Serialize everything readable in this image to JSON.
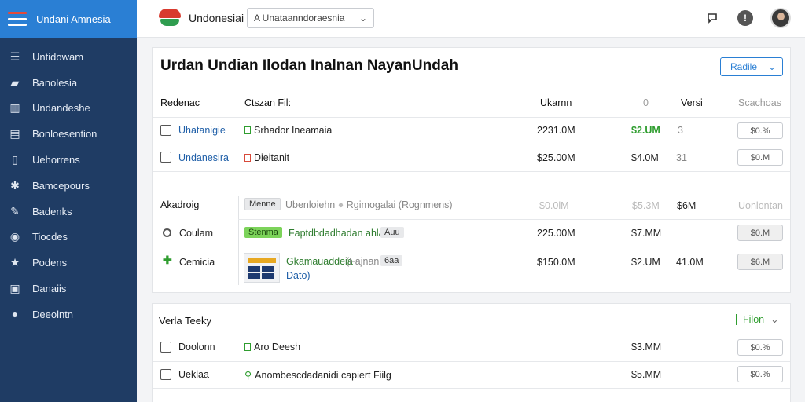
{
  "sidebar": {
    "title": "Undani Amnesia",
    "items": [
      {
        "label": "Untidowam",
        "icon": "list-icon"
      },
      {
        "label": "Banolesia",
        "icon": "bank-icon"
      },
      {
        "label": "Undandeshe",
        "icon": "chart-icon"
      },
      {
        "label": "Bonloesention",
        "icon": "document-icon"
      },
      {
        "label": "Uehorrens",
        "icon": "book-icon"
      },
      {
        "label": "Bamcepours",
        "icon": "puzzle-icon"
      },
      {
        "label": "Badenks",
        "icon": "pencil-icon"
      },
      {
        "label": "Tiocdes",
        "icon": "circle-icon"
      },
      {
        "label": "Podens",
        "icon": "star-icon"
      },
      {
        "label": "Danaiis",
        "icon": "briefcase-icon"
      },
      {
        "label": "Deeolntn",
        "icon": "search-icon"
      }
    ]
  },
  "topbar": {
    "site_name": "Undonesiai",
    "language_value": "A Unataanndoraesnia",
    "icons": [
      "chat-icon",
      "help-icon",
      "user-avatar"
    ]
  },
  "main": {
    "title": "Urdan Undian Ilodan Inalnan NayanUndah",
    "action_button": "Radile",
    "headers": [
      "Redenac",
      "Ctszan Fil:",
      "Ukarnn",
      "0",
      "Versi",
      "Scachoas"
    ],
    "rows": [
      {
        "name": "Uhatanigie",
        "tag": "Srhador Ineamaia",
        "amount": "2231.0M",
        "value": "$2.UM",
        "count": "3",
        "button": "$0.%"
      },
      {
        "name": "Undanesira",
        "tag": "Dieitanit",
        "amount": "$25.00M",
        "value": "$4.0M",
        "count": "31",
        "button": "$0.M"
      }
    ],
    "group": {
      "label": "Akadroig",
      "tag": "Menne",
      "desc": "Ubenloiehn",
      "desc2": "Rgimogalai (Rognmens)",
      "amount": "$0.0lM",
      "value": "$5.3M",
      "count": "$6M",
      "action": "Uonlontan"
    },
    "group_rows": [
      {
        "name": "Coulam",
        "tag": "Stenma",
        "desc": "Faptdbdadhadan ahlaen",
        "tag2": "Auu",
        "amount": "225.00M",
        "value": "$7.MM",
        "count": "",
        "button": "$0.M"
      },
      {
        "name": "Cemicia",
        "tag": "Gkamauaddeia",
        "desc": "(Fajnan",
        "tag2": "6aa",
        "desc2": "Dato)",
        "amount": "$150.0M",
        "value": "$2.UM",
        "count": "41.0M",
        "button": "$6.M"
      }
    ]
  },
  "recent": {
    "title": "Verla Teeky",
    "filter_label": "Filon",
    "rows": [
      {
        "name": "Doolonn",
        "tag": "Aro Deesh",
        "value": "$3.MM",
        "button": "$0.%"
      },
      {
        "name": "Ueklaa",
        "tag": "Anombescdadanidi capiert Fiilg",
        "value": "$5.MM",
        "button": "$0.%"
      }
    ]
  },
  "colors": {
    "sidebar_bg": "#1f3c64",
    "brand_bg": "#2a7fd4",
    "accent_green": "#2f9d2f",
    "link_blue": "#1f5fa8"
  }
}
